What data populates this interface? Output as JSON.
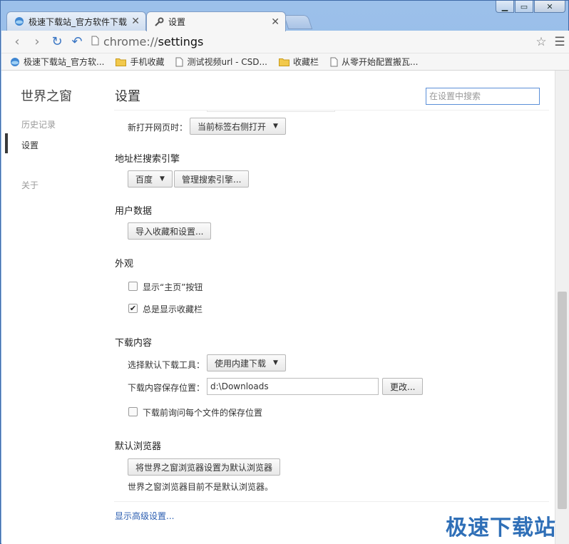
{
  "window": {
    "controls": {
      "minimize": "▁",
      "maximize": "▭",
      "close": "✕"
    }
  },
  "tabs": [
    {
      "label": "极速下载站_官方软件下载",
      "close": "✕",
      "icon": "site-favicon",
      "active": false
    },
    {
      "label": "设置",
      "close": "✕",
      "icon": "wrench-icon",
      "active": true
    }
  ],
  "toolbar": {
    "back": "‹",
    "forward": "›",
    "reload": "↻",
    "undo": "↶",
    "url_scheme": "chrome://",
    "url_path": "settings",
    "star": "☆",
    "menu": "☰"
  },
  "bookmarks": [
    {
      "label": "极速下载站_官方软...",
      "icon": "site-favicon"
    },
    {
      "label": "手机收藏",
      "icon": "folder-icon"
    },
    {
      "label": "测试视频url - CSD...",
      "icon": "page-icon"
    },
    {
      "label": "收藏栏",
      "icon": "folder-icon"
    },
    {
      "label": "从零开始配置搬瓦...",
      "icon": "page-icon"
    }
  ],
  "sidebar": {
    "brand": "世界之窗",
    "items": [
      {
        "label": "历史记录",
        "selected": false
      },
      {
        "label": "设置",
        "selected": true
      },
      {
        "label": "关于",
        "selected": false
      }
    ]
  },
  "header": {
    "title": "设置",
    "search_placeholder": "在设置中搜索"
  },
  "startup": {
    "new_page_label": "新打开网页时：",
    "new_page_value": "当前标签右侧打开"
  },
  "search_engine": {
    "title": "地址栏搜索引擎",
    "engine": "百度",
    "manage_button": "管理搜索引擎..."
  },
  "user_data": {
    "title": "用户数据",
    "import_button": "导入收藏和设置..."
  },
  "appearance": {
    "title": "外观",
    "show_home": {
      "label": "显示“主页”按钮",
      "checked": false
    },
    "show_bookmarks": {
      "label": "总是显示收藏栏",
      "checked": true
    }
  },
  "downloads": {
    "title": "下载内容",
    "tool_label": "选择默认下载工具：",
    "tool_value": "使用内建下载",
    "location_label": "下载内容保存位置：",
    "location_value": "d:\\Downloads",
    "change_button": "更改...",
    "ask_each": {
      "label": "下载前询问每个文件的保存位置",
      "checked": false
    }
  },
  "default_browser": {
    "title": "默认浏览器",
    "set_button": "将世界之窗浏览器设置为默认浏览器",
    "status": "世界之窗浏览器目前不是默认浏览器。"
  },
  "advanced_link": "显示高级设置...",
  "watermark": "极速下载站"
}
